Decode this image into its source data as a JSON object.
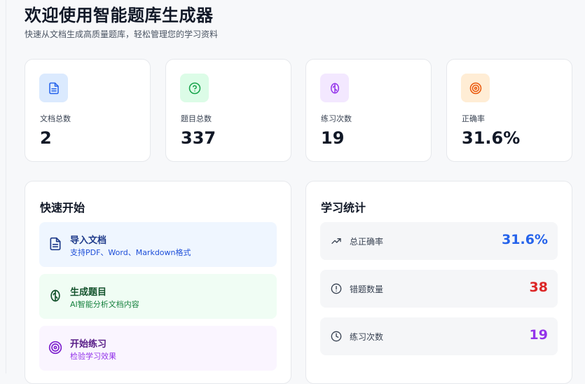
{
  "header": {
    "title": "欢迎使用智能题库生成器",
    "subtitle": "快速从文档生成高质量题库，轻松管理您的学习资料"
  },
  "stats": [
    {
      "icon": "document-icon",
      "label": "文档总数",
      "value": "2",
      "color": "#2563eb",
      "bg": "#dbeafe"
    },
    {
      "icon": "question-circle-icon",
      "label": "题目总数",
      "value": "337",
      "color": "#16a34a",
      "bg": "#dcfce7"
    },
    {
      "icon": "brain-icon",
      "label": "练习次数",
      "value": "19",
      "color": "#9333ea",
      "bg": "#f3e8ff"
    },
    {
      "icon": "target-icon",
      "label": "正确率",
      "value": "31.6%",
      "color": "#ea580c",
      "bg": "#ffedd5"
    }
  ],
  "quick_start": {
    "title": "快速开始",
    "items": [
      {
        "icon": "document-icon",
        "title": "导入文档",
        "desc": "支持PDF、Word、Markdown格式",
        "color": "#1e3a8a",
        "bg": "#eff6ff"
      },
      {
        "icon": "brain-icon",
        "title": "生成题目",
        "desc": "AI智能分析文档内容",
        "color": "#14532d",
        "bg": "#f0fdf4"
      },
      {
        "icon": "target-icon",
        "title": "开始练习",
        "desc": "检验学习效果",
        "color": "#581c87",
        "bg": "#faf5ff"
      }
    ]
  },
  "learning_stats": {
    "title": "学习统计",
    "rows": [
      {
        "icon": "trending-up-icon",
        "label": "总正确率",
        "value": "31.6%",
        "color": "#2563eb"
      },
      {
        "icon": "alert-circle-icon",
        "label": "错题数量",
        "value": "38",
        "color": "#dc2626"
      },
      {
        "icon": "clock-icon",
        "label": "练习次数",
        "value": "19",
        "color": "#9333ea"
      }
    ]
  }
}
